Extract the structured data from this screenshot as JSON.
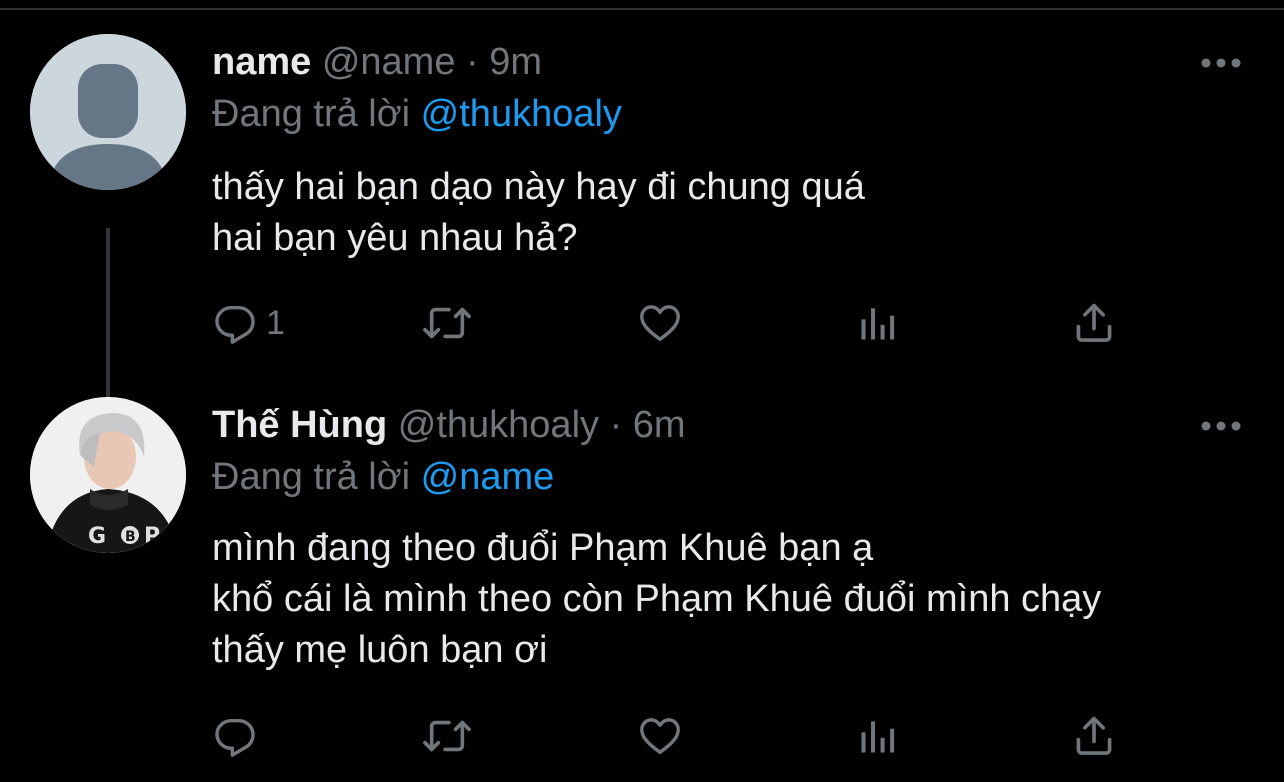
{
  "tweets": [
    {
      "display_name": "name",
      "handle": "@name",
      "separator": "·",
      "time": "9m",
      "reply_prefix": "Đang trả lời",
      "reply_to": "@thukhoaly",
      "text_lines": [
        "thấy hai bạn dạo này hay đi chung quá",
        "hai bạn yêu nhau hả?"
      ],
      "reply_count": "1",
      "avatar": "default-profile-icon"
    },
    {
      "display_name": "Thế Hùng",
      "handle": "@thukhoaly",
      "separator": "·",
      "time": "6m",
      "reply_prefix": "Đang trả lời",
      "reply_to": "@name",
      "text_lines": [
        "mình đang theo đuổi Phạm Khuê bạn ạ",
        "khổ cái là mình theo còn Phạm Khuê đuổi mình chạy",
        "thấy mẹ luôn bạn ơi"
      ],
      "reply_count": "",
      "avatar": "profile-photo"
    }
  ],
  "icons": {
    "reply": "reply-icon",
    "retweet": "retweet-icon",
    "like": "heart-icon",
    "analytics": "analytics-icon",
    "share": "share-icon",
    "more": "more-icon"
  },
  "colors": {
    "background": "#000000",
    "text": "#e7e9ea",
    "secondary": "#71767b",
    "accent": "#1d9bf0",
    "thread_line": "#333639"
  }
}
